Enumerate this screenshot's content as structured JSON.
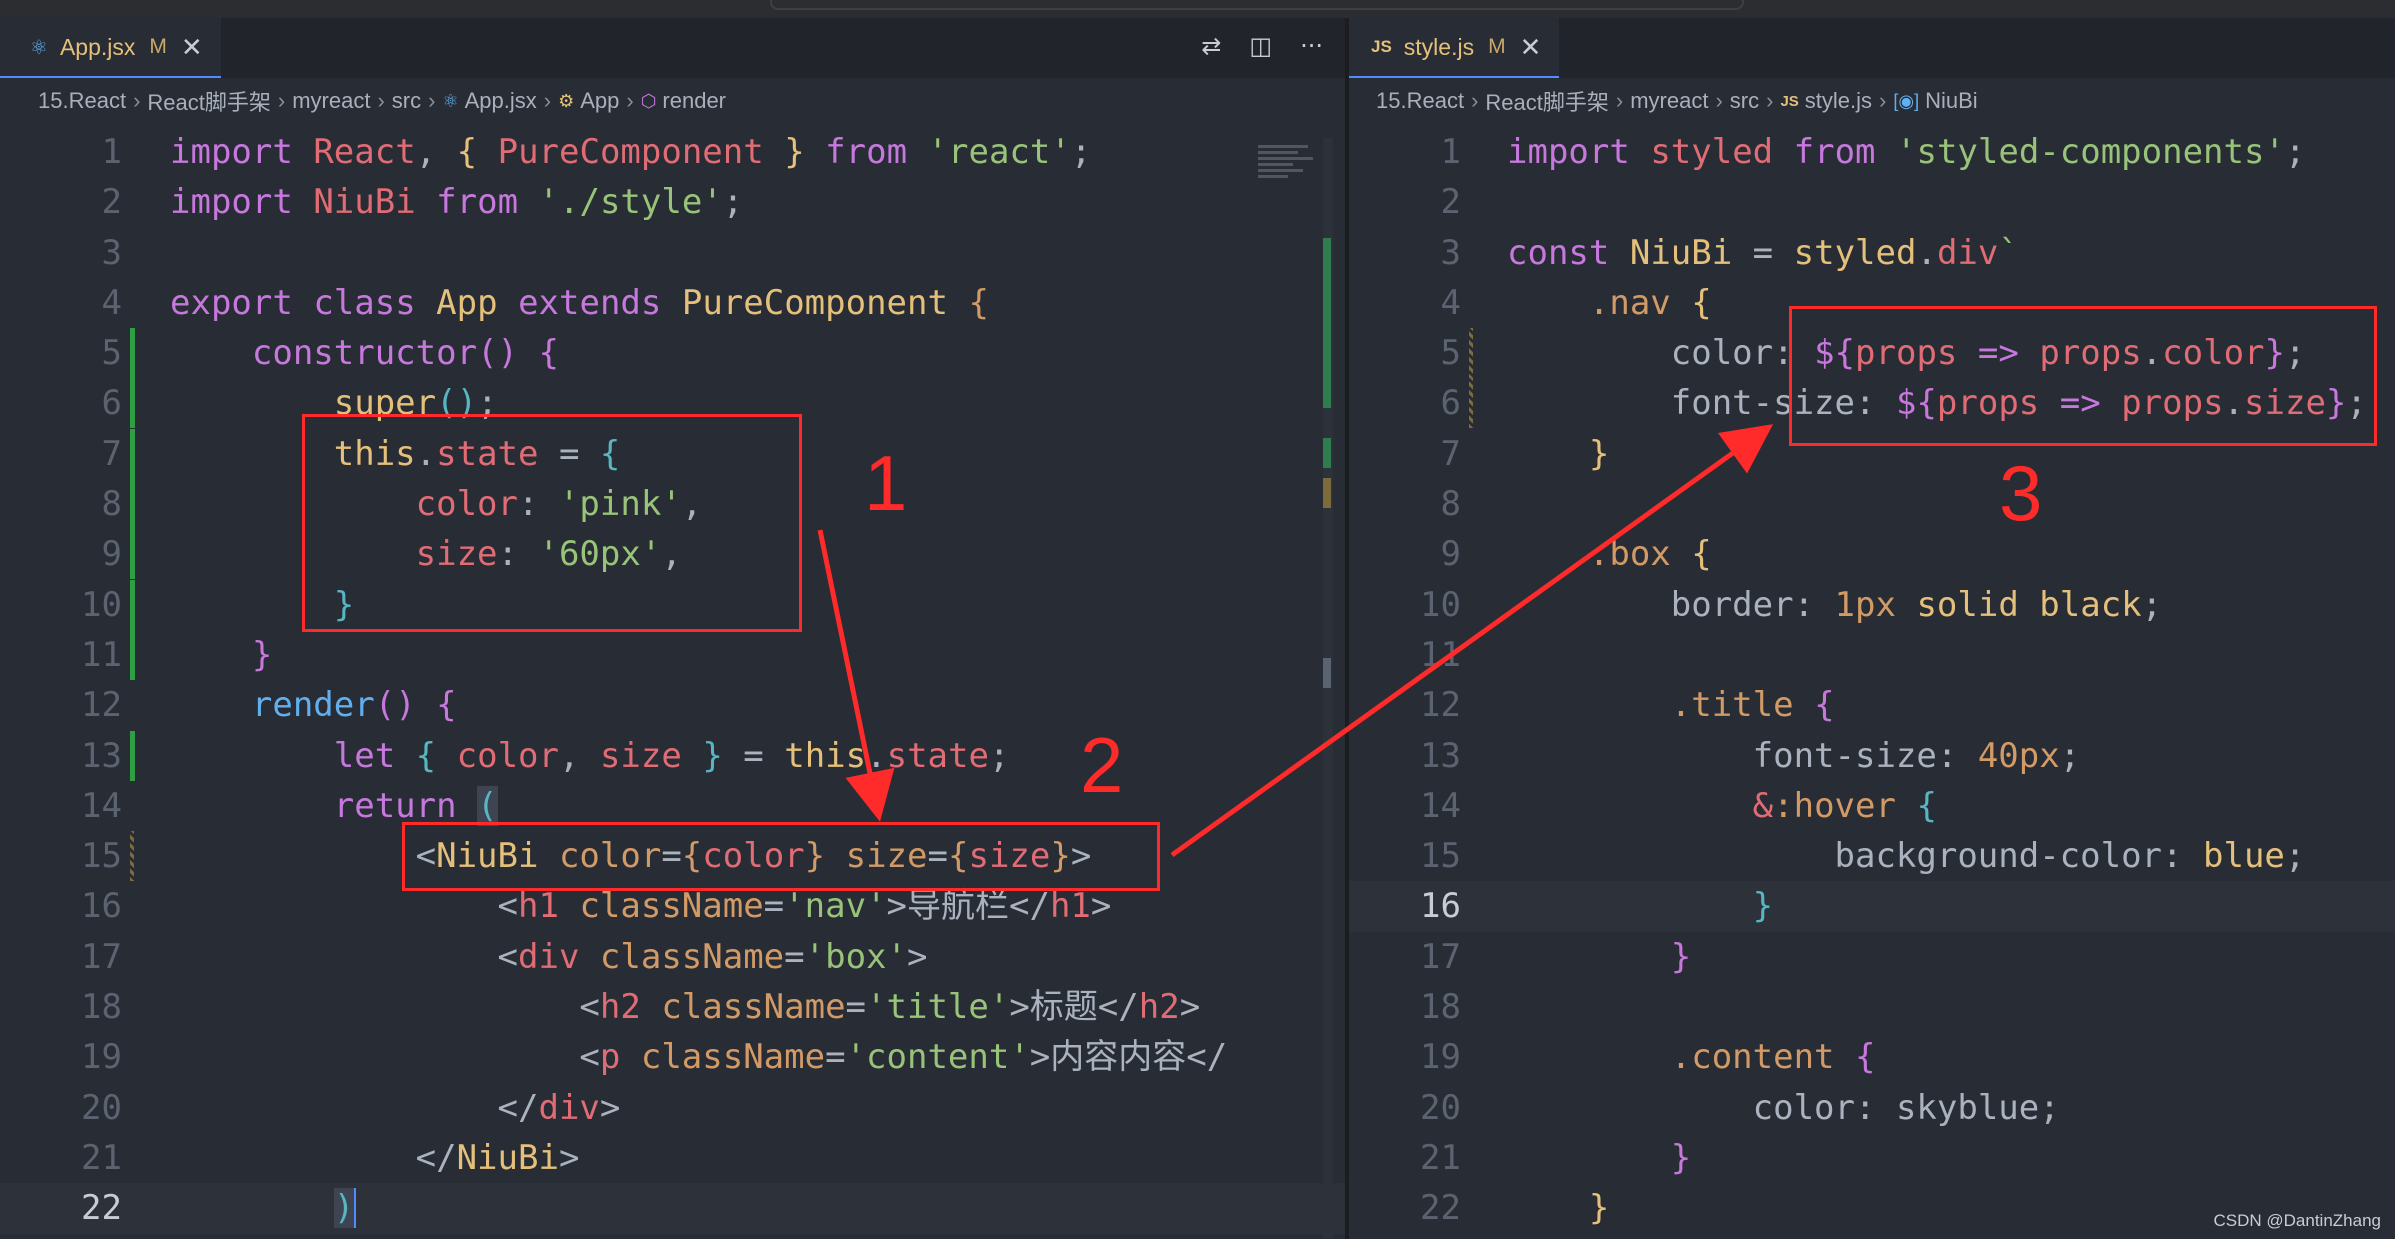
{
  "left": {
    "tab": {
      "label": "App.jsx",
      "modified": "M",
      "close": "✕"
    },
    "actions": {
      "compare": "compare-icon",
      "split": "split-editor-icon",
      "more": "···"
    },
    "breadcrumb": [
      "15.React",
      "React脚手架",
      "myreact",
      "src",
      "App.jsx",
      "App",
      "render"
    ],
    "line_numbers": [
      "1",
      "2",
      "3",
      "4",
      "5",
      "6",
      "7",
      "8",
      "9",
      "10",
      "11",
      "12",
      "13",
      "14",
      "15",
      "16",
      "17",
      "18",
      "19",
      "20",
      "21",
      "22"
    ],
    "current_line": "22"
  },
  "right": {
    "tab": {
      "label": "style.js",
      "modified": "M",
      "close": "✕",
      "icon": "JS"
    },
    "breadcrumb": [
      "15.React",
      "React脚手架",
      "myreact",
      "src",
      "style.js",
      "NiuBi"
    ],
    "line_numbers": [
      "1",
      "2",
      "3",
      "4",
      "5",
      "6",
      "7",
      "8",
      "9",
      "10",
      "11",
      "12",
      "13",
      "14",
      "15",
      "16",
      "17",
      "18",
      "19",
      "20",
      "21",
      "22"
    ],
    "current_line": "16"
  },
  "annotations": {
    "one": "1",
    "two": "2",
    "three": "3"
  },
  "watermark": "CSDN @DantinZhang",
  "colors": {
    "accent": "#ff2a2a",
    "editor_bg": "#282c34",
    "keyword": "#c678dd",
    "string": "#98c379"
  }
}
